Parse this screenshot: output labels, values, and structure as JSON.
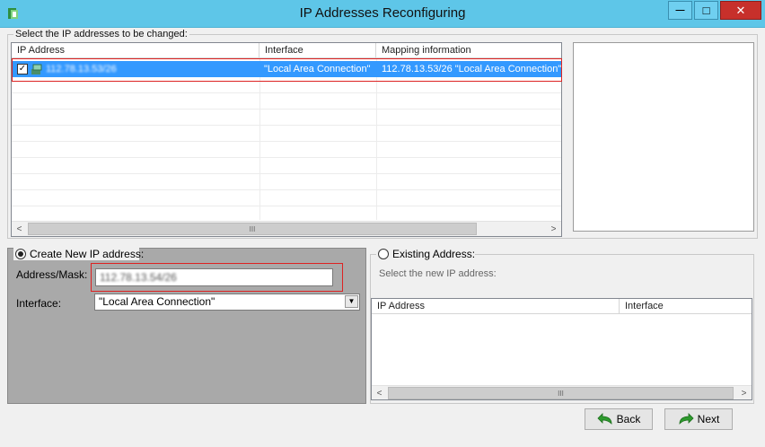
{
  "window": {
    "title": "IP Addresses Reconfiguring",
    "controls": {
      "minimize": "—",
      "maximize": "□",
      "close": "✕"
    }
  },
  "top_group": {
    "title": "Select the IP addresses to be changed:",
    "columns": [
      "IP Address",
      "Interface",
      "Mapping information"
    ],
    "rows": [
      {
        "checked": true,
        "ip": "112.78.13.53/26",
        "interface": "\"Local Area Connection\"",
        "mapping": "112.78.13.53/26 \"Local Area Connection\""
      }
    ],
    "scroll_thumb": "III"
  },
  "create_new": {
    "radio_label": "Create New IP address:",
    "selected": true,
    "address_label": "Address/Mask:",
    "address_value": "112.78.13.54/26",
    "interface_label": "Interface:",
    "interface_value": "\"Local Area Connection\""
  },
  "existing": {
    "radio_label": "Existing Address:",
    "selected": false,
    "instruction": "Select the new IP address:",
    "columns": [
      "IP Address",
      "Interface"
    ],
    "scroll_thumb": "III"
  },
  "buttons": {
    "back": "Back",
    "next": "Next"
  },
  "colors": {
    "titlebar": "#5ec6e8",
    "selection": "#3399ff",
    "highlight_border": "#dd2222",
    "button_icon": "#2e9b2e"
  },
  "icons": {
    "app": "app-icon",
    "row": "network-adapter-icon",
    "back": "back-arrow-icon",
    "next": "next-arrow-icon"
  }
}
